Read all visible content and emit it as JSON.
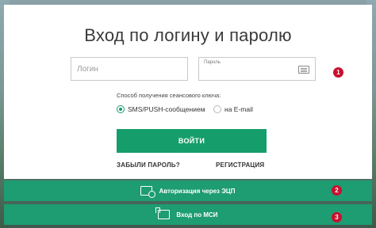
{
  "page": {
    "title": "Вход по логину и паролю"
  },
  "form": {
    "login_placeholder": "Логин",
    "password_label": "Пароль",
    "key_method_label": "Способ получения сеансового ключа:",
    "options": [
      {
        "label": "SMS/PUSH-сообщением",
        "selected": true
      },
      {
        "label": "на E-mail",
        "selected": false
      }
    ],
    "submit_label": "ВОЙТИ",
    "forgot_label": "ЗАБЫЛИ ПАРОЛЬ?",
    "register_label": "РЕГИСТРАЦИЯ"
  },
  "alt_logins": [
    {
      "label": "Авторизация через ЭЦП",
      "badge": "2",
      "icon": "certificate-card-icon"
    },
    {
      "label": "Вход по МСИ",
      "badge": "3",
      "icon": "computer-icon"
    }
  ],
  "badges": {
    "password": "1"
  },
  "colors": {
    "accent": "#159e6c",
    "bar": "#1e9c72",
    "badge": "#c8102e"
  }
}
